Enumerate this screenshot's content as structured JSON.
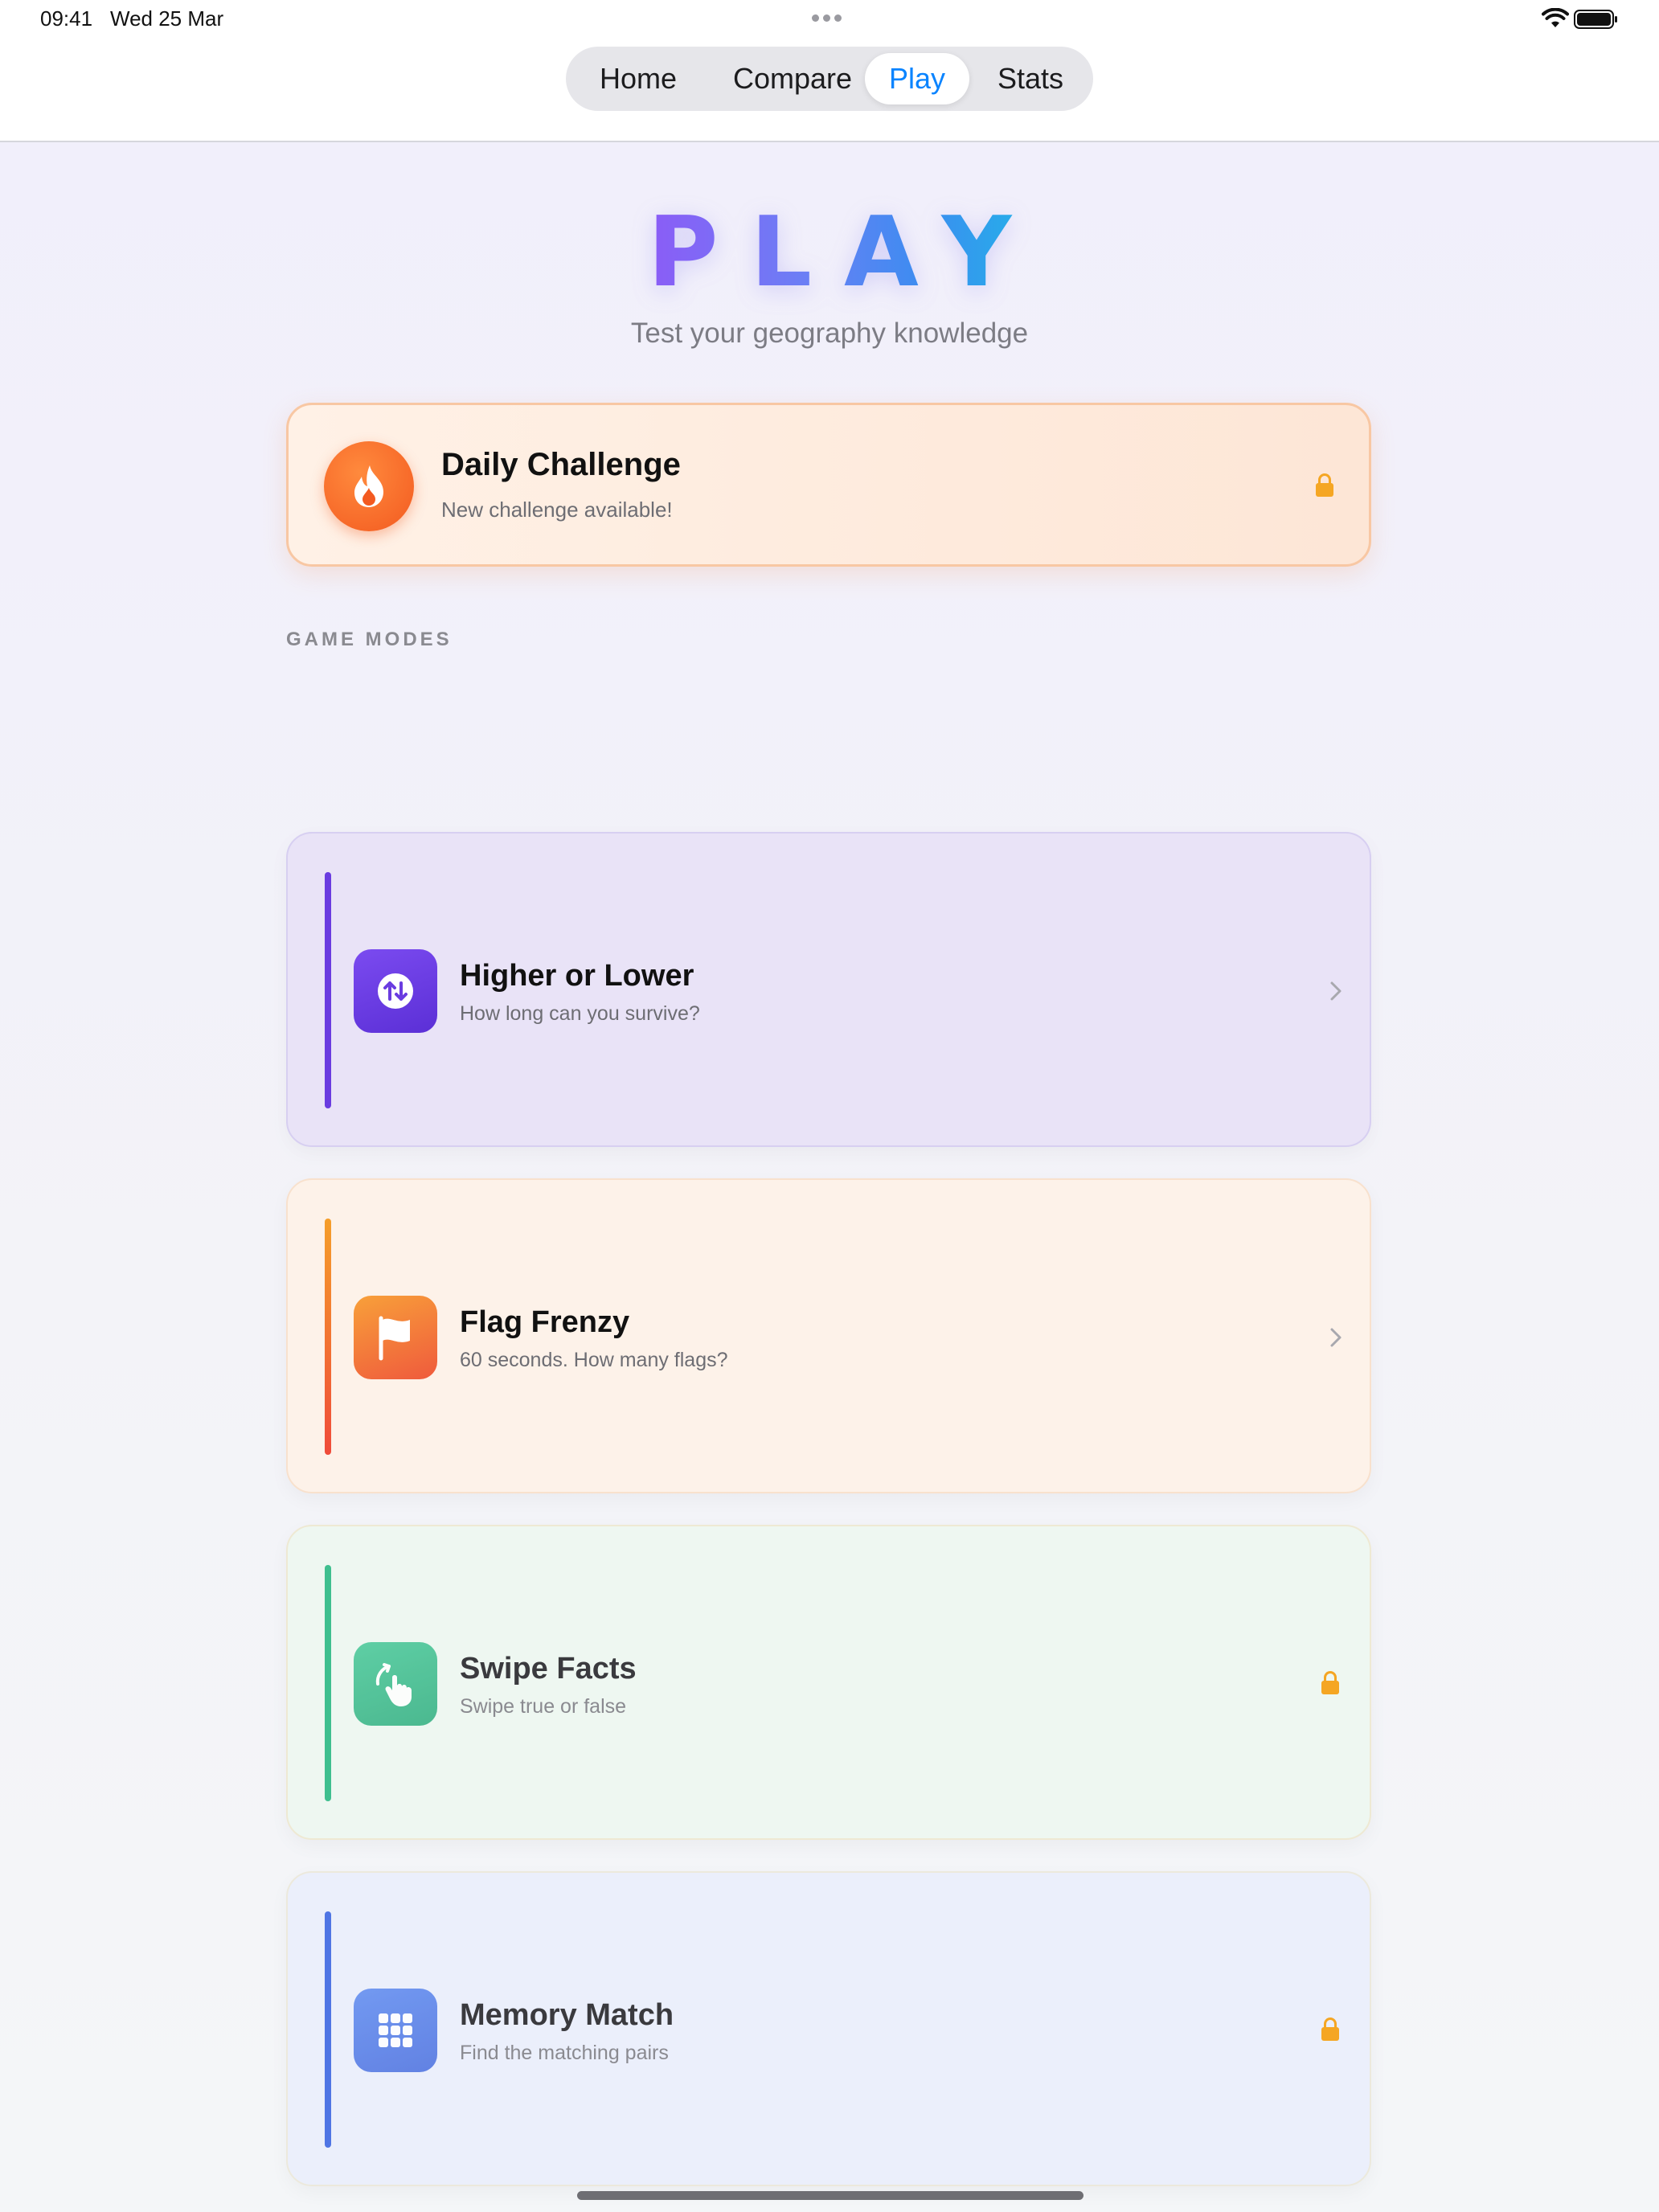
{
  "status_bar": {
    "time": "09:41",
    "date": "Wed 25 Mar"
  },
  "nav": {
    "tabs": [
      {
        "label": "Home",
        "active": false
      },
      {
        "label": "Compare",
        "active": false
      },
      {
        "label": "Play",
        "active": true
      },
      {
        "label": "Stats",
        "active": false
      }
    ]
  },
  "header": {
    "title": "PLAY",
    "subtitle": "Test your geography knowledge"
  },
  "daily_challenge": {
    "title": "Daily Challenge",
    "subtitle": "New challenge available!",
    "icon": "flame-icon",
    "locked": true
  },
  "section_label": "GAME MODES",
  "modes": [
    {
      "title": "Higher or Lower",
      "subtitle": "How long can you survive?",
      "icon": "arrows-up-down-icon",
      "locked": false,
      "accent": "#6a3ce0"
    },
    {
      "title": "Flag Frenzy",
      "subtitle": "60 seconds. How many flags?",
      "icon": "flag-icon",
      "locked": false,
      "accent": "#f59e2a"
    },
    {
      "title": "Swipe Facts",
      "subtitle": "Swipe true or false",
      "icon": "swipe-hand-icon",
      "locked": true,
      "accent": "#3fbf8f"
    },
    {
      "title": "Memory Match",
      "subtitle": "Find the matching pairs",
      "icon": "grid-icon",
      "locked": true,
      "accent": "#4f75e4"
    }
  ],
  "colors": {
    "active_tab": "#0a84ff",
    "lock": "#f5a623",
    "daily_accent": "#f35a20"
  }
}
